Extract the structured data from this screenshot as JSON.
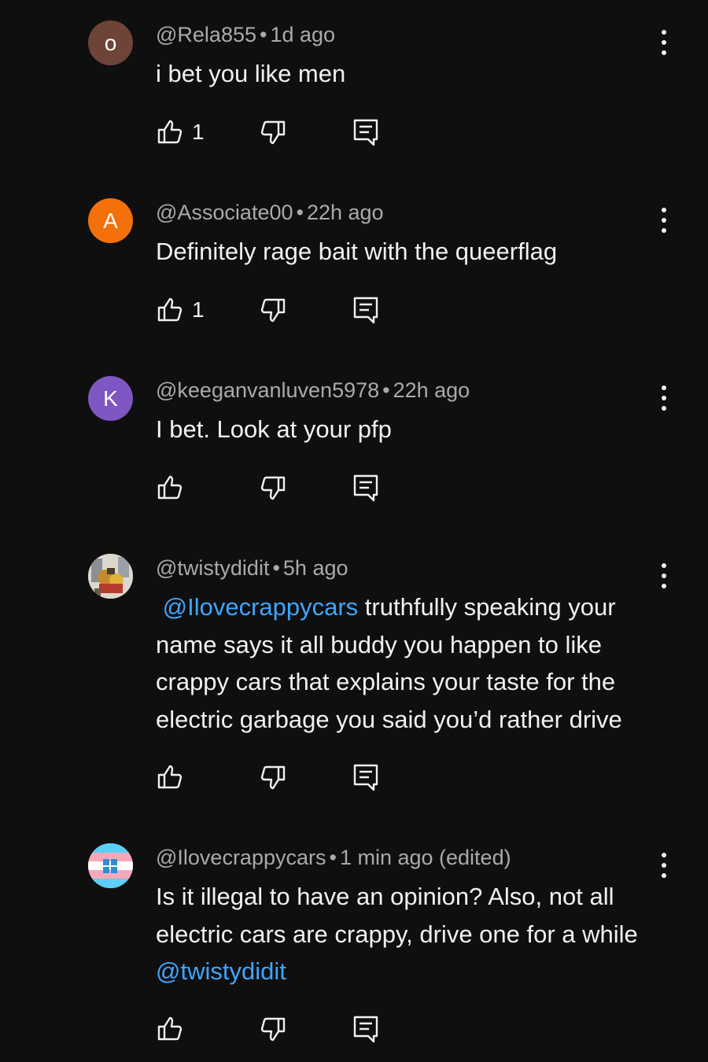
{
  "comments": [
    {
      "avatar_letter": "o",
      "avatar_color": "#6d4437",
      "author": "@Rela855",
      "time": "1d ago",
      "text": "i bet you like men",
      "likes": "1"
    },
    {
      "avatar_letter": "A",
      "avatar_color": "#f4700b",
      "author": "@Associate00",
      "time": "22h ago",
      "text": "Definitely rage bait with the queerflag",
      "likes": "1"
    },
    {
      "avatar_letter": "K",
      "avatar_color": "#7e57c2",
      "author": "@keeganvanluven5978",
      "time": "22h ago",
      "text": "I bet. Look at your pfp",
      "likes": ""
    },
    {
      "avatar_letter": "",
      "avatar_color": "#e9e4d8",
      "author": "@twistydidit",
      "time": "5h ago",
      "mention": "@Ilovecrappycars",
      "text": " truthfully speaking your name says it all buddy you happen to like crappy cars that explains your taste for the electric garbage you said you’d rather drive",
      "likes": ""
    },
    {
      "avatar_letter": "",
      "avatar_color": "#f7f7f7",
      "author": "@Ilovecrappycars",
      "time": "1 min ago (edited)",
      "text": "Is it illegal to have an opinion? Also, not all electric cars are crappy, drive one for a while ",
      "mention": "@twistydidit",
      "likes": ""
    }
  ],
  "icons": {
    "like": "thumbs-up-icon",
    "dislike": "thumbs-down-icon",
    "reply": "reply-icon",
    "more": "more-vertical-icon"
  },
  "colors": {
    "background": "#0f0f0f",
    "text": "#f1f1f1",
    "meta": "#aaaaaa",
    "mention": "#3ea6ff"
  }
}
